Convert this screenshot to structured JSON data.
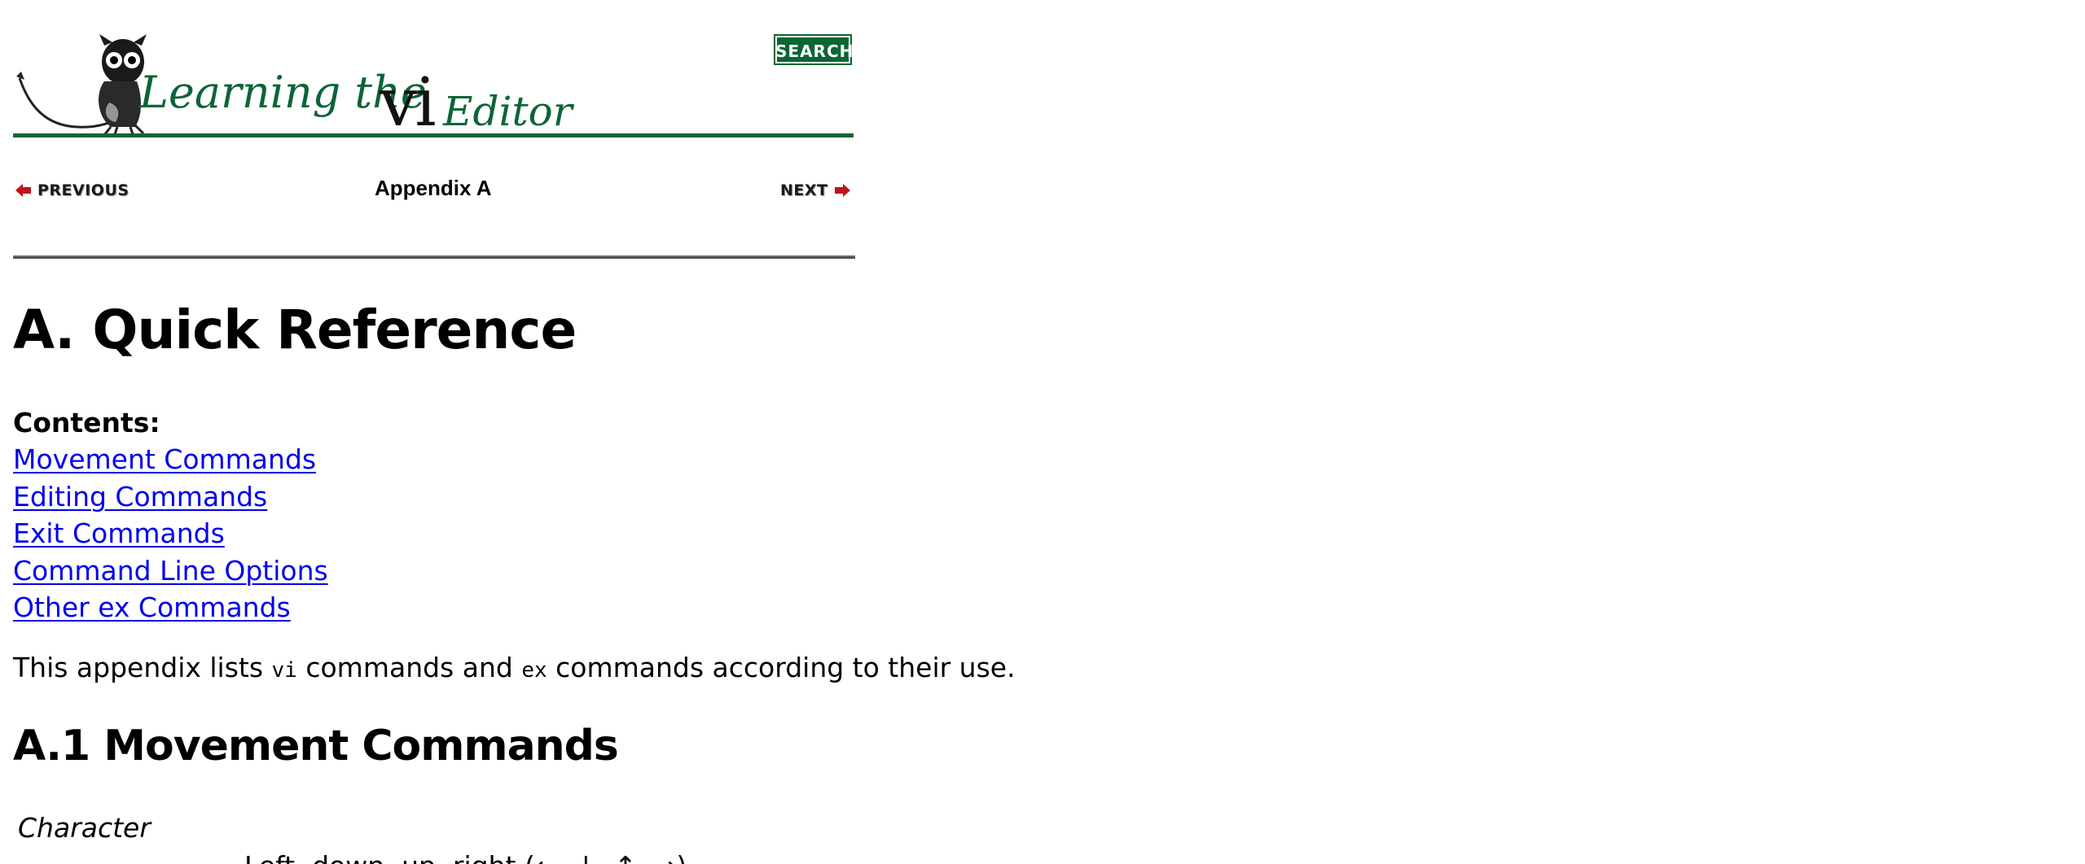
{
  "banner": {
    "logo_text_prefix": "Learning the",
    "logo_text_vi": "vi",
    "logo_text_suffix": "Editor",
    "search_label": "SEARCH",
    "colors": {
      "green": "#0b6535",
      "rule_green": "#0b6535"
    }
  },
  "nav": {
    "previous_label": "PREVIOUS",
    "next_label": "NEXT",
    "appendix_label": "Appendix A",
    "arrow_color": "#c0141a"
  },
  "main": {
    "title": "A. Quick Reference",
    "contents_label": "Contents:",
    "toc": [
      {
        "label": "Movement Commands"
      },
      {
        "label": "Editing Commands"
      },
      {
        "label": "Exit Commands"
      },
      {
        "label": "Command Line Options"
      },
      {
        "label": "Other ex Commands"
      }
    ],
    "intro": {
      "part1": "This appendix lists ",
      "code1": "vi",
      "part2": " commands and ",
      "code2": "ex",
      "part3": " commands according to their use."
    },
    "section_title": "A.1 Movement Commands",
    "subsection_label": "Character",
    "cutoff_line": "Left, down, up, right (←, ↓, ↑, →)."
  },
  "colors": {
    "link": "#0000ee",
    "text": "#000000",
    "rule": "#6b6b6b"
  }
}
